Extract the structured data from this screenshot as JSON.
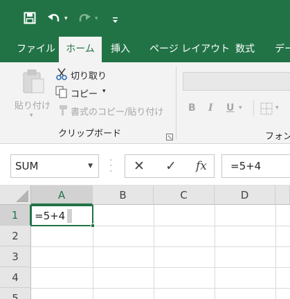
{
  "qat": {
    "save_icon": "save-icon",
    "undo_icon": "undo-icon",
    "redo_icon": "redo-icon",
    "customize_icon": "customize-qat-icon"
  },
  "tabs": [
    {
      "label": "ファイル"
    },
    {
      "label": "ホーム"
    },
    {
      "label": "挿入"
    },
    {
      "label": "ページ レイアウト"
    },
    {
      "label": "数式"
    },
    {
      "label": "デー"
    }
  ],
  "clipboard": {
    "paste_label": "貼り付け",
    "cut_label": "切り取り",
    "copy_label": "コピー",
    "format_painter_label": "書式のコピー/貼り付け",
    "group_label": "クリップボード"
  },
  "font_group": {
    "bold": "B",
    "italic": "I",
    "underline": "U",
    "group_label": "フォント"
  },
  "formula_bar": {
    "name_box": "SUM",
    "cancel_icon": "cancel-icon",
    "enter_icon": "enter-icon",
    "function_label": "fx",
    "formula": "=5+4"
  },
  "grid": {
    "columns": [
      "A",
      "B",
      "C",
      "D"
    ],
    "rows": [
      "1",
      "2",
      "3",
      "4",
      "5"
    ],
    "active_cell_value": "=5+4"
  },
  "colors": {
    "accent": "#217346",
    "ribbon": "#f3f3f3"
  }
}
